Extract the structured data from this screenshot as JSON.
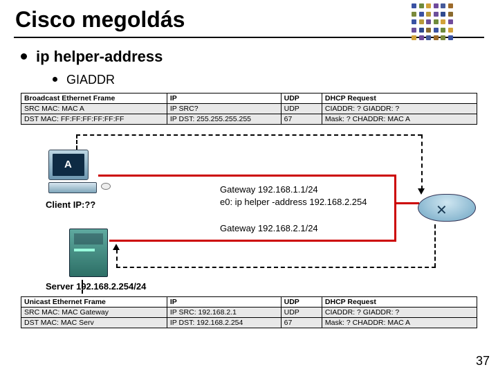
{
  "title": "Cisco megoldás",
  "bullet1": "ip helper-address",
  "bullet2": "GIADDR",
  "page_number": "37",
  "decor_colors": [
    "#3a52a3",
    "#6e8b3d",
    "#d2a23a",
    "#704a9c",
    "#455a9a",
    "#9c6a2a",
    "#7a8a3c",
    "#3a52a3",
    "#b89a3a",
    "#6c4f9a",
    "#2f4a8f",
    "#8a6a2e"
  ],
  "pkt_top": {
    "headers": [
      "Broadcast Ethernet Frame",
      "IP",
      "UDP",
      "DHCP Request"
    ],
    "r1c1": "SRC MAC: MAC A",
    "r1c2": "IP SRC?",
    "r1c3": "UDP",
    "r1c4": "CIADDR: ?   GIADDR: ?",
    "r2c1": "DST MAC: FF:FF:FF:FF:FF:FF",
    "r2c2": "IP DST: 255.255.255.255",
    "r2c3": "67",
    "r2c4": "Mask:      ?   CHADDR: MAC A"
  },
  "pkt_bottom": {
    "headers": [
      "Unicast Ethernet Frame",
      "IP",
      "UDP",
      "DHCP Request"
    ],
    "r1c1": "SRC MAC: MAC Gateway",
    "r1c2": "IP SRC: 192.168.2.1",
    "r1c3": "UDP",
    "r1c4": "CIADDR: ?   GIADDR: ?",
    "r2c1": "DST MAC: MAC Serv",
    "r2c2": "IP DST: 192.168.2.254",
    "r2c3": "67",
    "r2c4": "Mask:      ?   CHADDR: MAC A"
  },
  "labels": {
    "pc_letter": "A",
    "client_ip": "Client IP:??",
    "gw_top": "Gateway 192.168.1.1/24",
    "helper": "e0: ip helper -address 192.168.2.254",
    "gw_bot": "Gateway 192.168.2.1/24",
    "server": "Server 192.168.2.254/24"
  }
}
